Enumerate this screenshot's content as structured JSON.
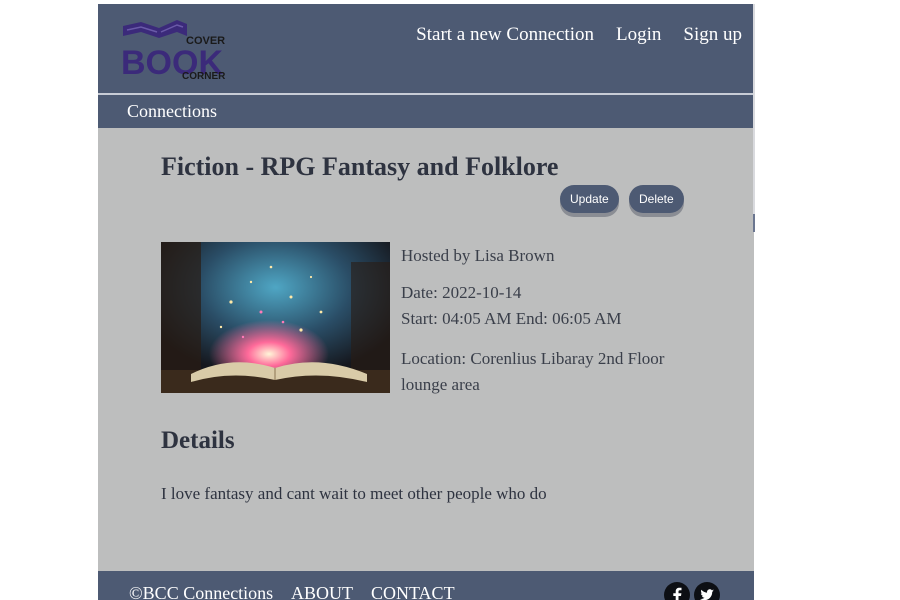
{
  "header": {
    "logo": {
      "top_word": "COVER",
      "main_word": "BOOK",
      "bottom_word": "CORNER"
    },
    "nav": [
      {
        "label": "Start a new Connection"
      },
      {
        "label": "Login"
      },
      {
        "label": "Sign up"
      }
    ]
  },
  "subnav": {
    "label": "Connections"
  },
  "event": {
    "title": "Fiction - RPG Fantasy and Folklore",
    "update_label": "Update",
    "delete_label": "Delete",
    "image": {
      "subject": "open glowing book with magical sparkles"
    },
    "host": "Hosted by Lisa Brown",
    "date": "Date: 2022-10-14",
    "times": "Start: 04:05 AM End: 06:05 AM",
    "location": "Location: Corenlius Libaray 2nd Floor lounge area"
  },
  "details": {
    "heading": "Details",
    "text": "I love fantasy and cant wait to meet other people who do"
  },
  "footer": {
    "copyright": "©BCC Connections",
    "about": "ABOUT",
    "contact": "CONTACT",
    "social": [
      {
        "icon": "facebook-icon"
      },
      {
        "icon": "twitter-icon"
      }
    ]
  },
  "colors": {
    "nav_bg": "#4d5a73",
    "page_bg": "#bdbebe",
    "logo_purple": "#3b2a7a",
    "text_dark": "#2e3340"
  }
}
